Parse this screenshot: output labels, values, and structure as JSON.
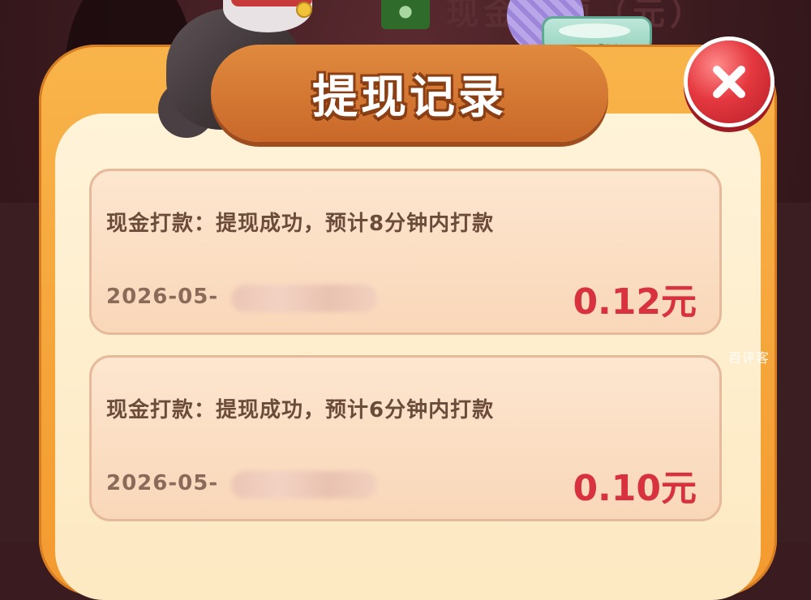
{
  "header": {
    "title": "提现记录",
    "close_icon": "close-icon"
  },
  "background": {
    "partial_text": "现金余额（元）"
  },
  "records": [
    {
      "description": "现金打款：提现成功，预计8分钟内打款",
      "date_prefix": "2026-05-",
      "amount": "0.12元"
    },
    {
      "description": "现金打款：提现成功，预计6分钟内打款",
      "date_prefix": "2026-05-",
      "amount": "0.10元"
    }
  ],
  "watermark": "百评客",
  "colors": {
    "panel_orange": "#f39a2f",
    "amount_red": "#d8323f",
    "close_red": "#e4383f"
  }
}
